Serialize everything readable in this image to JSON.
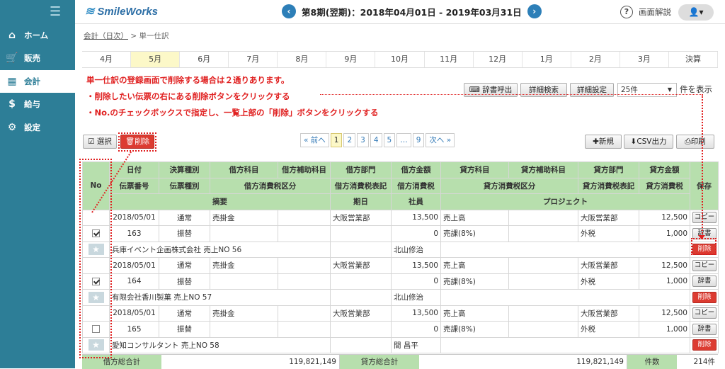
{
  "sidebar": {
    "items": [
      {
        "label": "ホーム",
        "icon": "home-icon"
      },
      {
        "label": "販売",
        "icon": "cart-icon"
      },
      {
        "label": "会計",
        "icon": "calculator-icon"
      },
      {
        "label": "給与",
        "icon": "money-bag-icon"
      },
      {
        "label": "設定",
        "icon": "gear-icon"
      }
    ]
  },
  "header": {
    "logo": "SmileWorks",
    "period": "第8期(翌期)：2018年04月01日 - 2019年03月31日",
    "help": "画面解説"
  },
  "breadcrumb": {
    "link": "会計（日次）",
    "sep": ">",
    "current": "単一仕訳"
  },
  "months": [
    "4月",
    "5月",
    "6月",
    "7月",
    "8月",
    "9月",
    "10月",
    "11月",
    "12月",
    "1月",
    "2月",
    "3月",
    "決算"
  ],
  "selected_month": "5月",
  "annotation": {
    "line1": "単一仕訳の登録画面で削除する場合は２通りあります。",
    "line2": "・削除したい伝票の右にある削除ボタンをクリックする",
    "line3": "・No.のチェックボックスで指定し、一覧上部の「削除」ボタンをクリックする"
  },
  "toolbar": {
    "dict": "辞書呼出",
    "search": "詳細検索",
    "settings": "詳細設定",
    "per_page": "25件",
    "per_page_suffix": "件を表示",
    "select": "選択",
    "delete": "削除",
    "new": "新規",
    "csv": "CSV出力",
    "print": "印刷"
  },
  "pager": {
    "prev": "« 前へ",
    "pages": [
      "1",
      "2",
      "3",
      "4",
      "5",
      "…",
      "9"
    ],
    "next": "次へ »"
  },
  "table": {
    "h1": [
      "No",
      "日付",
      "決算種別",
      "借方科目",
      "借方補助科目",
      "借方部門",
      "借方金額",
      "貸方科目",
      "貸方補助科目",
      "貸方部門",
      "貸方金額",
      "保存"
    ],
    "h2": [
      "伝票番号",
      "伝票種別",
      "借方消費税区分",
      "借方消費税表記",
      "借方消費税",
      "貸方消費税区分",
      "貸方消費税表記",
      "貸方消費税"
    ],
    "h3": [
      "摘要",
      "期日",
      "社員",
      "プロジェクト"
    ],
    "rows": [
      {
        "date": "2018/05/01",
        "closing": "通常",
        "debit": "売掛金",
        "dept": "大阪営業部",
        "amount": "13,500",
        "credit": "売上高",
        "cdept": "大阪営業部",
        "camount": "12,500",
        "no": "163",
        "kind": "振替",
        "dtax": "0",
        "ctax_kbn": "売課(8%)",
        "ctax_note": "外税",
        "ctax": "1,000",
        "memo": "兵庫イベント企画株式会社 売上NO 56",
        "staff": "北山修治",
        "checked": true
      },
      {
        "date": "2018/05/01",
        "closing": "通常",
        "debit": "売掛金",
        "dept": "大阪営業部",
        "amount": "13,500",
        "credit": "売上高",
        "cdept": "大阪営業部",
        "camount": "12,500",
        "no": "164",
        "kind": "振替",
        "dtax": "0",
        "ctax_kbn": "売課(8%)",
        "ctax_note": "外税",
        "ctax": "1,000",
        "memo": "有限会社香川製菓 売上NO 57",
        "staff": "北山修治",
        "checked": true
      },
      {
        "date": "2018/05/01",
        "closing": "通常",
        "debit": "売掛金",
        "dept": "大阪営業部",
        "amount": "13,500",
        "credit": "売上高",
        "cdept": "大阪営業部",
        "camount": "12,500",
        "no": "165",
        "kind": "振替",
        "dtax": "0",
        "ctax_kbn": "売課(8%)",
        "ctax_note": "外税",
        "ctax": "1,000",
        "memo": "愛知コンサルタント 売上NO 58",
        "staff": "間 昌平",
        "checked": false
      }
    ],
    "row_buttons": {
      "copy": "コピー",
      "dict": "辞書",
      "delete": "削除"
    }
  },
  "totals": {
    "debit_label": "借方総合計",
    "debit": "119,821,149",
    "credit_label": "貸方総合計",
    "credit": "119,821,149",
    "count_label": "件数",
    "count": "214件"
  }
}
